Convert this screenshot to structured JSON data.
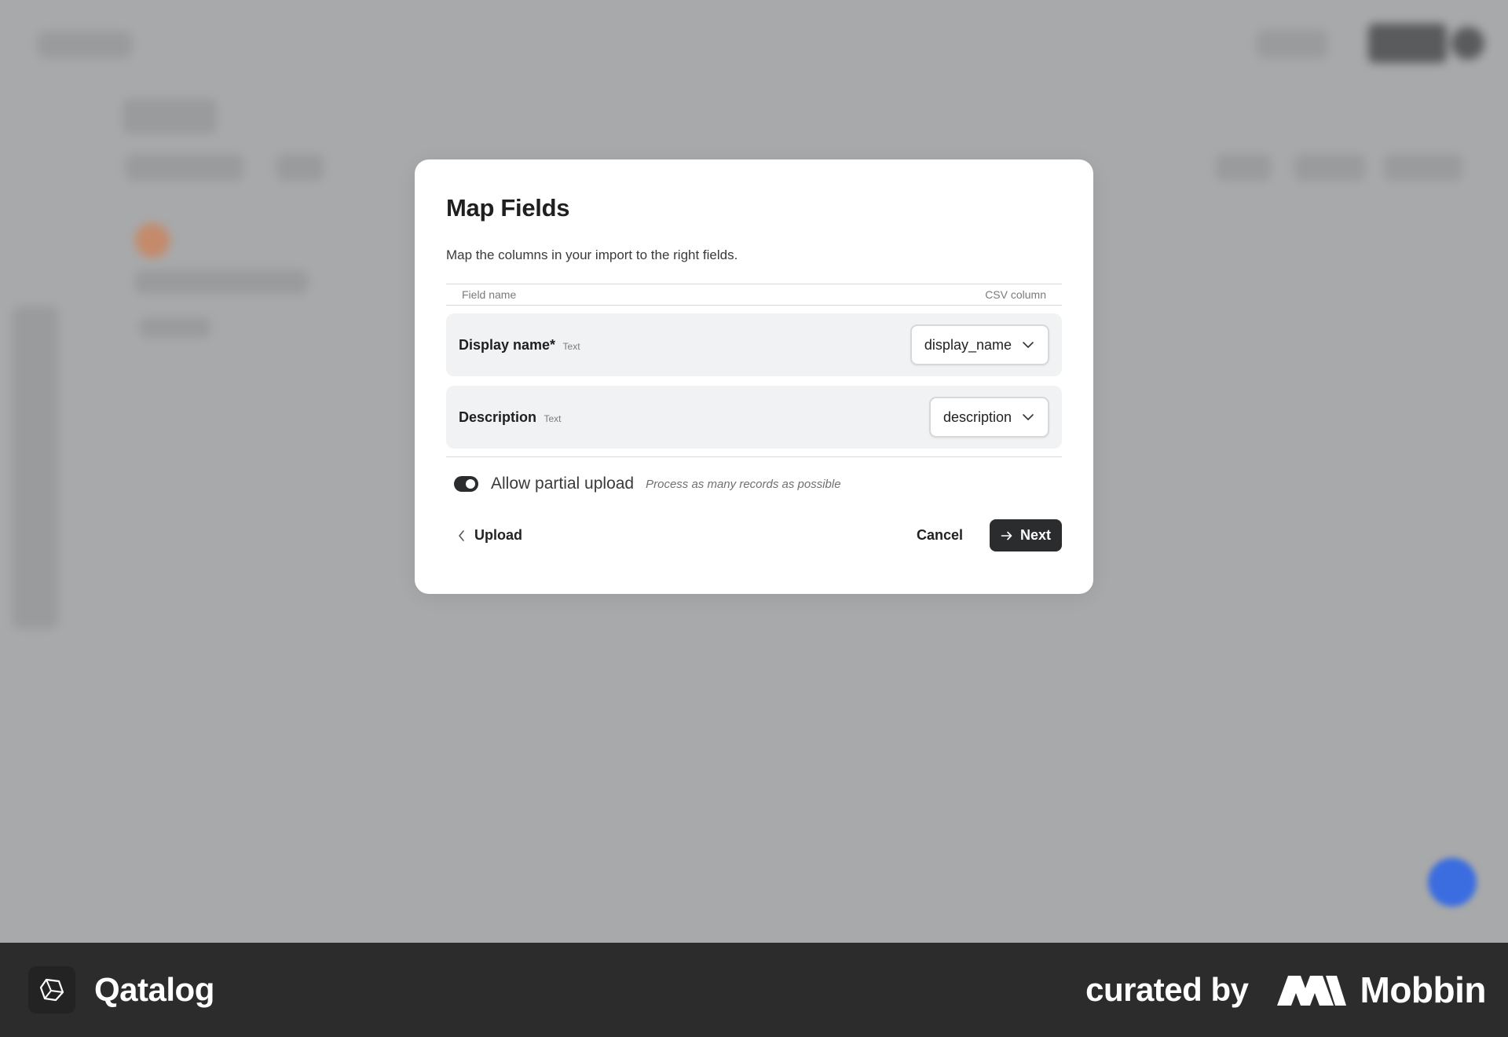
{
  "modal": {
    "title": "Map Fields",
    "subtitle": "Map the columns in your import to the right fields.",
    "table_head": {
      "field_name": "Field name",
      "csv_column": "CSV column"
    },
    "rows": [
      {
        "name": "Display name*",
        "type": "Text",
        "column": "display_name"
      },
      {
        "name": "Description",
        "type": "Text",
        "column": "description"
      }
    ],
    "partial_upload": {
      "label": "Allow partial upload",
      "hint": "Process as many records as possible",
      "enabled": true
    },
    "back_label": "Upload",
    "cancel_label": "Cancel",
    "next_label": "Next"
  },
  "footer": {
    "app_name": "Qatalog",
    "curated_by": "curated by",
    "curator": "Mobbin"
  },
  "icons": {
    "select": "chevron-down-icon",
    "back": "chevron-left-icon",
    "next": "arrow-right-icon",
    "app": "qatalog-logo-icon",
    "curator": "mobbin-logo-icon"
  },
  "colors": {
    "overlay": "#a9aaab",
    "primary_button": "#2b2c2d",
    "row_background": "#f1f2f3",
    "fab": "#3b6de0"
  }
}
